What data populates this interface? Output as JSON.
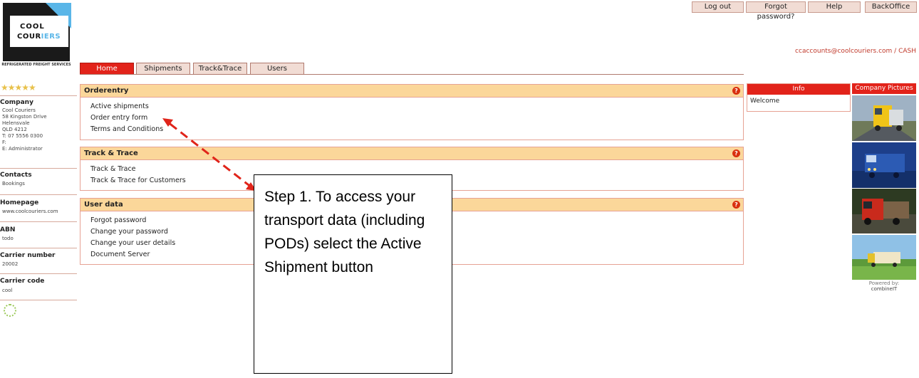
{
  "logo": {
    "line1": "COOL",
    "line2_dark": "COUR",
    "line2_blue": "IERS",
    "tagline": "REFRIGERATED FREIGHT SERVICES"
  },
  "top_buttons": [
    "Log out",
    "Forgot password?",
    "Help",
    "BackOffice"
  ],
  "user_line": "ccaccounts@coolcouriers.com / CASH",
  "tabs": [
    "Home",
    "Shipments",
    "Track&Trace",
    "Users"
  ],
  "active_tab": "Home",
  "sidebar": {
    "stars": "★★★★★",
    "company_heading": "Company",
    "company_lines": [
      "Cool Couriers",
      "58 Kingston Drive",
      "Helensvale",
      "QLD 4212",
      "T: 07 5556 0300",
      "F:",
      "E: Administrator"
    ],
    "contacts_heading": "Contacts",
    "contacts_value": "Bookings",
    "homepage_heading": "Homepage",
    "homepage_value": "www.coolcouriers.com",
    "abn_heading": "ABN",
    "abn_value": "todo",
    "carrier_number_heading": "Carrier number",
    "carrier_number_value": "20002",
    "carrier_code_heading": "Carrier code",
    "carrier_code_value": "cool"
  },
  "panels": [
    {
      "title": "Orderentry",
      "links": [
        "Active shipments",
        "Order entry form",
        "Terms and Conditions"
      ]
    },
    {
      "title": "Track & Trace",
      "links": [
        "Track & Trace",
        "Track & Trace for Customers"
      ]
    },
    {
      "title": "User data",
      "links": [
        "Forgot password",
        "Change your password",
        "Change your user details",
        "Document Server"
      ]
    }
  ],
  "help_glyph": "?",
  "info": {
    "title": "Info",
    "body": "Welcome"
  },
  "company_pictures": {
    "title": "Company Pictures"
  },
  "powered": {
    "label": "Powered by:",
    "brand": "combineIT"
  },
  "callout": {
    "text": "Step 1. To access your transport data (including PODs) select the Active Shipment button"
  },
  "colors": {
    "accent_red": "#e2231a",
    "panel_header": "#fbd79a",
    "tab_bg": "#f1dcd4",
    "logo_blue": "#5ab6e8",
    "link_red": "#c0392b"
  }
}
